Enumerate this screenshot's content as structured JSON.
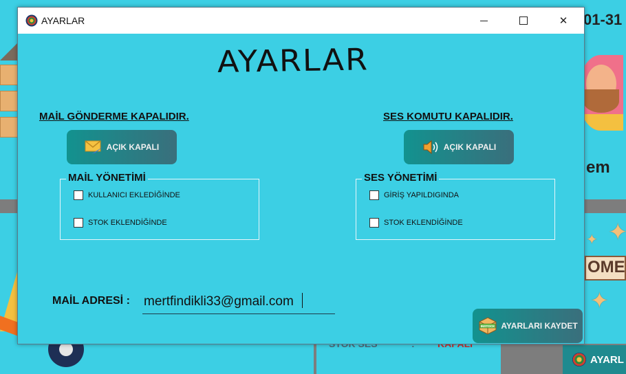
{
  "background": {
    "header_fragment": "01-31",
    "side_fragment": "em",
    "home_fragment": "OME",
    "stok_ses": "STOK SES",
    "colon": ":",
    "kapali": "KAPALI",
    "taskbar_button": "AYARL"
  },
  "window": {
    "title": "AYARLAR",
    "heading": "AYARLAR",
    "controls": {
      "minimize": "minimize",
      "maximize": "maximize",
      "close": "✕"
    }
  },
  "mail": {
    "status_label": "MAİL GÖNDERME KAPALIDIR.",
    "toggle_label": "AÇIK KAPALI",
    "group_title": "MAİL YÖNETİMİ",
    "options": [
      "KULLANICI EKLEDİĞİNDE",
      "STOK EKLENDİĞİNDE"
    ]
  },
  "ses": {
    "status_label": "SES KOMUTU KAPALIDIR.",
    "toggle_label": "AÇIK KAPALI",
    "group_title": "SES YÖNETİMİ",
    "options": [
      "GİRİŞ YAPILDIGINDA",
      "STOK EKLENDİĞİNDE"
    ]
  },
  "mail_address": {
    "label": "MAİL ADRESİ :",
    "value": "mertfindikli33@gmail.com"
  },
  "save": {
    "label": "AYARLARI KAYDET",
    "logo_text": "INSTOCK"
  },
  "colors": {
    "background": "#3ccfe4",
    "button": "#12928f"
  }
}
